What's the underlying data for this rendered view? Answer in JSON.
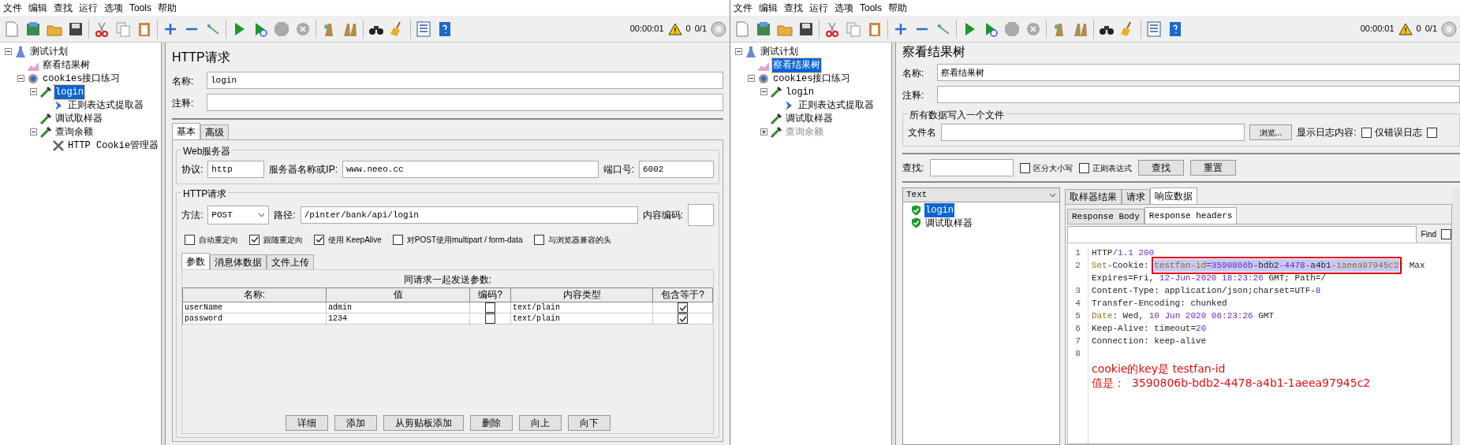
{
  "windows": [
    {
      "menu": [
        "文件",
        "编辑",
        "查找",
        "运行",
        "选项",
        "Tools",
        "帮助"
      ],
      "toolbar": {
        "timer": "00:00:01",
        "warnings": "0",
        "threads": "0/1"
      },
      "tree": [
        {
          "label": "测试计划",
          "kind": "plan",
          "selected": false,
          "disabled": false,
          "expanded": true,
          "children": [
            {
              "label": "察看结果树",
              "kind": "listener",
              "selected": false,
              "disabled": false
            },
            {
              "label": "cookies接口练习",
              "kind": "thread_group",
              "selected": false,
              "disabled": false,
              "expanded": true,
              "children": [
                {
                  "label": "login",
                  "kind": "sampler",
                  "selected": true,
                  "disabled": false,
                  "expanded": true,
                  "children": [
                    {
                      "label": "正则表达式提取器",
                      "kind": "extractor",
                      "selected": false,
                      "disabled": false
                    }
                  ]
                },
                {
                  "label": "调试取样器",
                  "kind": "sampler",
                  "selected": false,
                  "disabled": false
                },
                {
                  "label": "查询余额",
                  "kind": "sampler",
                  "selected": false,
                  "disabled": false,
                  "expanded": true,
                  "children": [
                    {
                      "label": "HTTP Cookie管理器",
                      "kind": "config",
                      "selected": false,
                      "disabled": false
                    }
                  ]
                }
              ]
            }
          ]
        }
      ],
      "panel": {
        "kind": "http_request",
        "title": "HTTP请求",
        "name_label": "名称:",
        "name_value": "login",
        "comment_label": "注释:",
        "tabs": [
          {
            "label": "基本",
            "selected": true
          },
          {
            "label": "高级",
            "selected": false
          }
        ],
        "web_server": {
          "legend": "Web服务器",
          "protocol_label": "协议:",
          "protocol": "http",
          "server_label": "服务器名称或IP:",
          "server": "www.neeo.cc",
          "port_label": "端口号:",
          "port": "6002"
        },
        "http": {
          "legend": "HTTP请求",
          "method_label": "方法:",
          "method": "POST",
          "path_label": "路径:",
          "path": "/pinter/bank/api/login",
          "encoding_label": "内容编码:",
          "options": [
            {
              "label": "自动重定向",
              "checked": false
            },
            {
              "label": "跟随重定向",
              "checked": true
            },
            {
              "label": "使用 KeepAlive",
              "checked": true
            },
            {
              "label": "对POST使用multipart / form-data",
              "checked": false
            },
            {
              "label": "与浏览器兼容的头",
              "checked": false
            }
          ],
          "tabs": [
            {
              "label": "参数",
              "selected": true
            },
            {
              "label": "消息体数据",
              "selected": false
            },
            {
              "label": "文件上传",
              "selected": false
            }
          ],
          "caption": "同请求一起发送参数:",
          "columns": [
            "名称:",
            "值",
            "编码?",
            "内容类型",
            "包含等于?"
          ],
          "rows": [
            {
              "name": "userName",
              "value": "admin",
              "encode": false,
              "content_type": "text/plain",
              "include_equals": true
            },
            {
              "name": "password",
              "value": "1234",
              "encode": false,
              "content_type": "text/plain",
              "include_equals": true
            }
          ],
          "buttons": [
            "详细",
            "添加",
            "从剪贴板添加",
            "删除",
            "向上",
            "向下"
          ]
        }
      }
    },
    {
      "menu": [
        "文件",
        "编辑",
        "查找",
        "运行",
        "选项",
        "Tools",
        "帮助"
      ],
      "toolbar": {
        "timer": "00:00:01",
        "warnings": "0",
        "threads": "0/1"
      },
      "tree": [
        {
          "label": "测试计划",
          "kind": "plan",
          "selected": false,
          "disabled": false,
          "expanded": true,
          "children": [
            {
              "label": "察看结果树",
              "kind": "listener",
              "selected": true,
              "disabled": false
            },
            {
              "label": "cookies接口练习",
              "kind": "thread_group",
              "selected": false,
              "disabled": false,
              "expanded": true,
              "children": [
                {
                  "label": "login",
                  "kind": "sampler",
                  "selected": false,
                  "disabled": false,
                  "expanded": true,
                  "children": [
                    {
                      "label": "正则表达式提取器",
                      "kind": "extractor",
                      "selected": false,
                      "disabled": false
                    }
                  ]
                },
                {
                  "label": "调试取样器",
                  "kind": "sampler",
                  "selected": false,
                  "disabled": false
                },
                {
                  "label": "查询余额",
                  "kind": "sampler",
                  "selected": false,
                  "disabled": true,
                  "expanded": false
                }
              ]
            }
          ]
        }
      ],
      "panel": {
        "kind": "results_tree",
        "title": "察看结果树",
        "name_label": "名称:",
        "name_value": "察看结果树",
        "comment_label": "注释:",
        "file": {
          "legend": "所有数据写入一个文件",
          "file_label": "文件名",
          "browse_button": "浏览...",
          "log_label": "显示日志内容:",
          "options": [
            {
              "label": "仅错误日志",
              "checked": false
            },
            {
              "checked": false
            }
          ]
        },
        "search": {
          "label": "查找:",
          "options": [
            {
              "label": "区分大小写",
              "checked": false
            },
            {
              "label": "正则表达式",
              "checked": false
            }
          ],
          "buttons": [
            "查找",
            "重置"
          ]
        },
        "renderer": "Text",
        "results": [
          {
            "label": "login",
            "selected": true
          },
          {
            "label": "调试取样器",
            "selected": false
          }
        ],
        "tabs": [
          {
            "label": "取样器结果",
            "selected": false
          },
          {
            "label": "请求",
            "selected": false
          },
          {
            "label": "响应数据",
            "selected": true
          }
        ],
        "subtabs": [
          {
            "label": "Response Body",
            "selected": false
          },
          {
            "label": "Response headers",
            "selected": true
          }
        ],
        "find": {
          "label": "Find",
          "checked": false
        },
        "lines": [
          {
            "number": "1",
            "segments": [
              {
                "text": "HTTP",
                "kind": "plain"
              },
              {
                "text": "/1.1 200",
                "kind": "number"
              }
            ]
          },
          {
            "number": "2",
            "segments": [
              {
                "text": "Set",
                "kind": "keyword",
                "highlighted": false
              },
              {
                "text": "-Cookie: ",
                "kind": "plain",
                "highlighted": false
              },
              {
                "text": "testfan-id",
                "kind": "keyword",
                "highlighted": true
              },
              {
                "text": "=3590806b",
                "kind": "number",
                "highlighted": true
              },
              {
                "text": "-bdb2",
                "kind": "plain",
                "highlighted": true
              },
              {
                "text": "-4478-",
                "kind": "number",
                "highlighted": true
              },
              {
                "text": "a4b1",
                "kind": "plain",
                "highlighted": true
              },
              {
                "text": "-1aeea97945c2",
                "kind": "keyword",
                "highlighted": true
              },
              {
                "text": "; Max",
                "kind": "plain",
                "highlighted": false
              }
            ]
          },
          {
            "segments": [
              {
                "text": "Expires=Fri, ",
                "kind": "plain"
              },
              {
                "text": "12-Jun-2020 18:23:26",
                "kind": "number"
              },
              {
                "text": " GMT; Path=/",
                "kind": "plain"
              }
            ]
          },
          {
            "number": "3",
            "segments": [
              {
                "text": "Content-Type: application/json;charset=UTF-",
                "kind": "plain"
              },
              {
                "text": "8",
                "kind": "number"
              }
            ]
          },
          {
            "number": "4",
            "segments": [
              {
                "text": "Transfer-Encoding: chunked",
                "kind": "plain"
              }
            ]
          },
          {
            "number": "5",
            "segments": [
              {
                "text": "Date",
                "kind": "keyword"
              },
              {
                "text": ": Wed, ",
                "kind": "plain"
              },
              {
                "text": "10 Jun 2020 06:23:26",
                "kind": "number"
              },
              {
                "text": " GMT",
                "kind": "plain"
              }
            ]
          },
          {
            "number": "6",
            "segments": [
              {
                "text": "Keep-Alive: timeout=",
                "kind": "plain"
              },
              {
                "text": "20",
                "kind": "number"
              }
            ]
          },
          {
            "number": "7",
            "segments": [
              {
                "text": "Connection: keep-alive",
                "kind": "plain"
              }
            ]
          },
          {
            "number": "8"
          }
        ],
        "annotation": [
          "cookie的key是 testfan-id",
          "值是：  3590806b-bdb2-4478-a4b1-1aeea97945c2"
        ]
      }
    }
  ]
}
